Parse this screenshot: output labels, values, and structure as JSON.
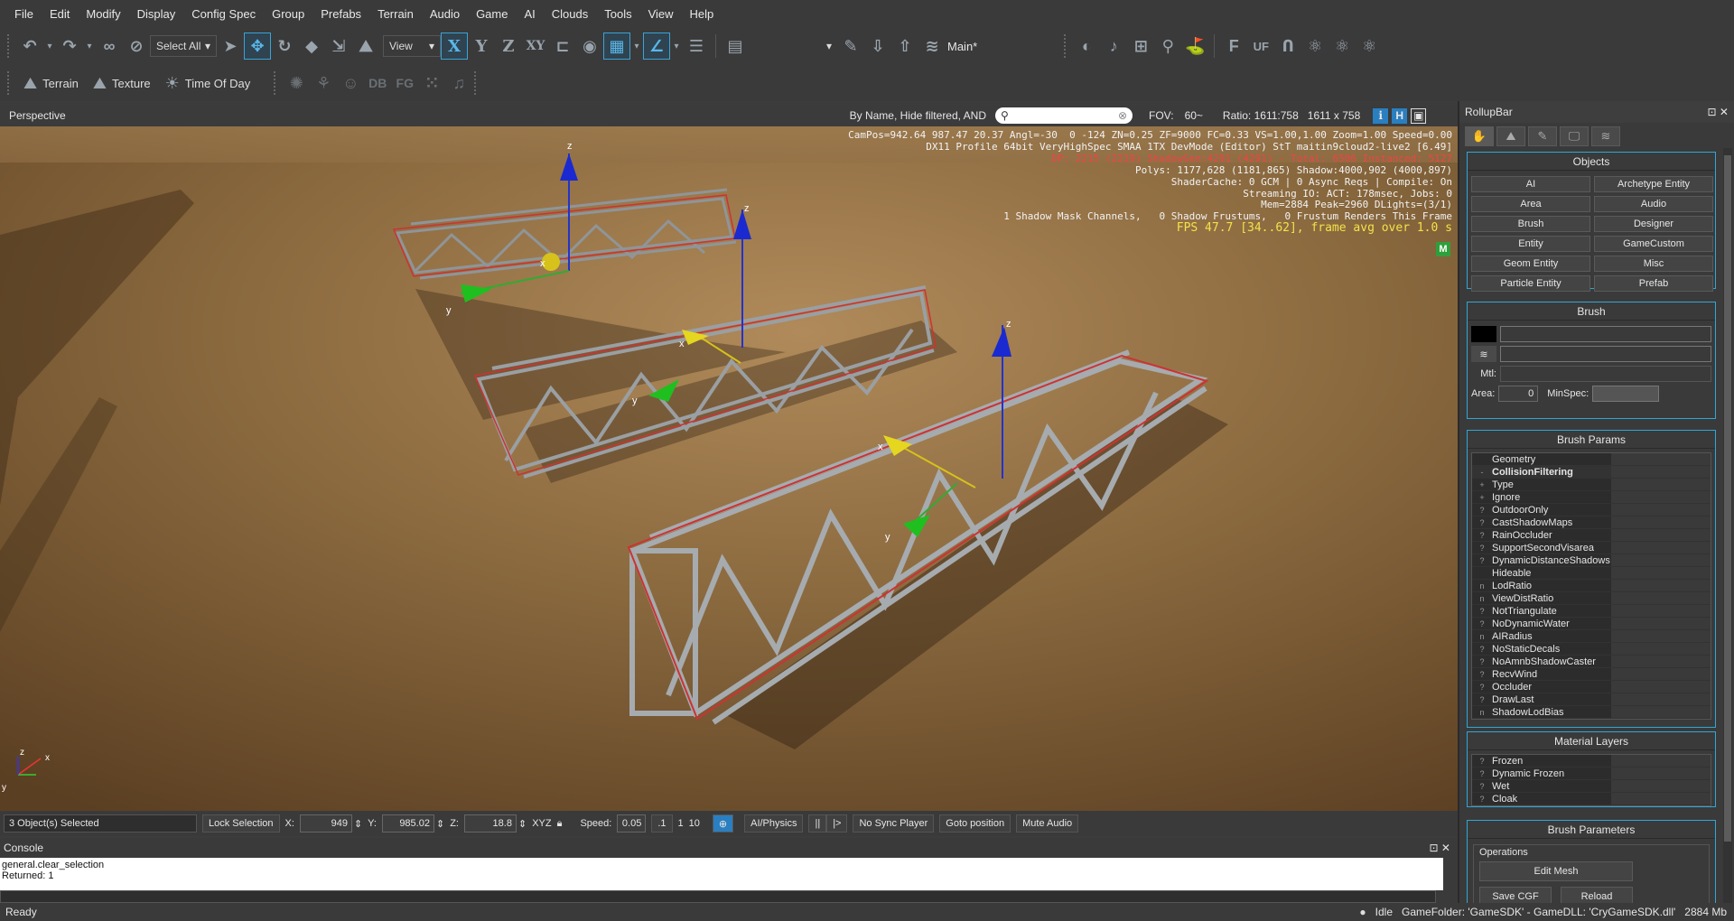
{
  "menu": [
    "File",
    "Edit",
    "Modify",
    "Display",
    "Config Spec",
    "Group",
    "Prefabs",
    "Terrain",
    "Audio",
    "Game",
    "AI",
    "Clouds",
    "Tools",
    "View",
    "Help"
  ],
  "toolbar": {
    "select_all": "Select All",
    "view_combo": "View",
    "axis_x": "X",
    "axis_y": "Y",
    "axis_z": "Z",
    "axis_xy": "XY",
    "layer_label": "Main*",
    "terrain": "Terrain",
    "texture": "Texture",
    "time_of_day": "Time Of Day",
    "db": "DB",
    "fg": "FG",
    "f_icon": "F",
    "uf_icon": "UF"
  },
  "viewport": {
    "title": "Perspective",
    "filter_label": "By Name, Hide filtered, AND",
    "fov_label": "FOV:",
    "fov_value": "60~",
    "ratio": "Ratio: 1611:758",
    "resolution": "1611 x 758",
    "btn_i": "i",
    "btn_h": "H",
    "stats": [
      "CamPos=942.64 987.47 20.37 Angl=-30  0 -124 ZN=0.25 ZF=9000 FC=0.33 VS=1.00,1.00 Zoom=1.00 Speed=0.00",
      "DX11 Profile 64bit VeryHighSpec SMAA 1TX DevMode (Editor) StT maitin9cloud2-live2 [6.49]",
      "Polys: 1177,628 (1181,865) Shadow:4000,902 (4000,897)",
      "ShaderCache: 0 GCM | 0 Async Reqs | Compile: On",
      "Streaming IO: ACT: 178msec, Jobs: 0",
      "Mem=2884 Peak=2960 DLights=(3/1)",
      "1 Shadow Mask Channels,   0 Shadow Frustums,   0 Frustum Renders This Frame"
    ],
    "stats_red": "DP: 2215 (2219) ShadowGen:4291 (4291) - Total: 6506 Instanced: 5127",
    "fps": "FPS 47.7 [34..62], frame avg over 1.0 s",
    "m_badge": "M",
    "gizmo_labels": {
      "x": "x",
      "y": "y",
      "z": "z"
    }
  },
  "statusrow": {
    "selected": "3 Object(s) Selected",
    "lock": "Lock Selection",
    "x_label": "X:",
    "x_value": "949",
    "y_label": "Y:",
    "y_value": "985.02",
    "z_label": "Z:",
    "z_value": "18.8",
    "xyz": "XYZ",
    "speed_label": "Speed:",
    "speed_value": "0.05",
    "speed_1": ".1",
    "speed_2": "1",
    "speed_3": "10",
    "ai_physics": "AI/Physics",
    "pause": "||",
    "step": "|>",
    "no_sync": "No Sync Player",
    "goto": "Goto position",
    "mute": "Mute Audio"
  },
  "console": {
    "title": "Console",
    "lines": [
      "general.clear_selection",
      "Returned: 1"
    ]
  },
  "bottombar": {
    "status": "Ready",
    "idle": "Idle",
    "gamefolder": "GameFolder: 'GameSDK' - GameDLL: 'CryGameSDK.dll'",
    "memory": "2884 Mb"
  },
  "rollup": {
    "title": "RollupBar",
    "objects_title": "Objects",
    "objects": [
      "AI",
      "Archetype Entity",
      "Area",
      "Audio",
      "Brush",
      "Designer",
      "Entity",
      "GameCustom",
      "Geom Entity",
      "Misc",
      "Particle Entity",
      "Prefab"
    ],
    "brush_title": "Brush",
    "mtl_label": "Mtl:",
    "area_label": "Area:",
    "area_value": "0",
    "minspec_label": "MinSpec:",
    "brush_params_title": "Brush Params",
    "params": [
      {
        "mark": "",
        "name": "Geometry",
        "bold": false
      },
      {
        "mark": "-",
        "name": "CollisionFiltering",
        "bold": true
      },
      {
        "mark": "+",
        "name": "Type",
        "bold": false
      },
      {
        "mark": "+",
        "name": "Ignore",
        "bold": false
      },
      {
        "mark": "?",
        "name": "OutdoorOnly",
        "bold": false
      },
      {
        "mark": "?",
        "name": "CastShadowMaps",
        "bold": false
      },
      {
        "mark": "?",
        "name": "RainOccluder",
        "bold": false
      },
      {
        "mark": "?",
        "name": "SupportSecondVisarea",
        "bold": false
      },
      {
        "mark": "?",
        "name": "DynamicDistanceShadows",
        "bold": false
      },
      {
        "mark": "",
        "name": "Hideable",
        "bold": false
      },
      {
        "mark": "n",
        "name": "LodRatio",
        "bold": false
      },
      {
        "mark": "n",
        "name": "ViewDistRatio",
        "bold": false
      },
      {
        "mark": "?",
        "name": "NotTriangulate",
        "bold": false
      },
      {
        "mark": "?",
        "name": "NoDynamicWater",
        "bold": false
      },
      {
        "mark": "n",
        "name": "AIRadius",
        "bold": false
      },
      {
        "mark": "?",
        "name": "NoStaticDecals",
        "bold": false
      },
      {
        "mark": "?",
        "name": "NoAmnbShadowCaster",
        "bold": false
      },
      {
        "mark": "?",
        "name": "RecvWind",
        "bold": false
      },
      {
        "mark": "?",
        "name": "Occluder",
        "bold": false
      },
      {
        "mark": "?",
        "name": "DrawLast",
        "bold": false
      },
      {
        "mark": "n",
        "name": "ShadowLodBias",
        "bold": false
      }
    ],
    "material_layers_title": "Material Layers",
    "material_layers": [
      "Frozen",
      "Dynamic Frozen",
      "Wet",
      "Cloak"
    ],
    "brush_parameters_title": "Brush Parameters",
    "operations_label": "Operations",
    "edit_mesh": "Edit Mesh",
    "save_cgf": "Save CGF",
    "reload": "Reload"
  }
}
